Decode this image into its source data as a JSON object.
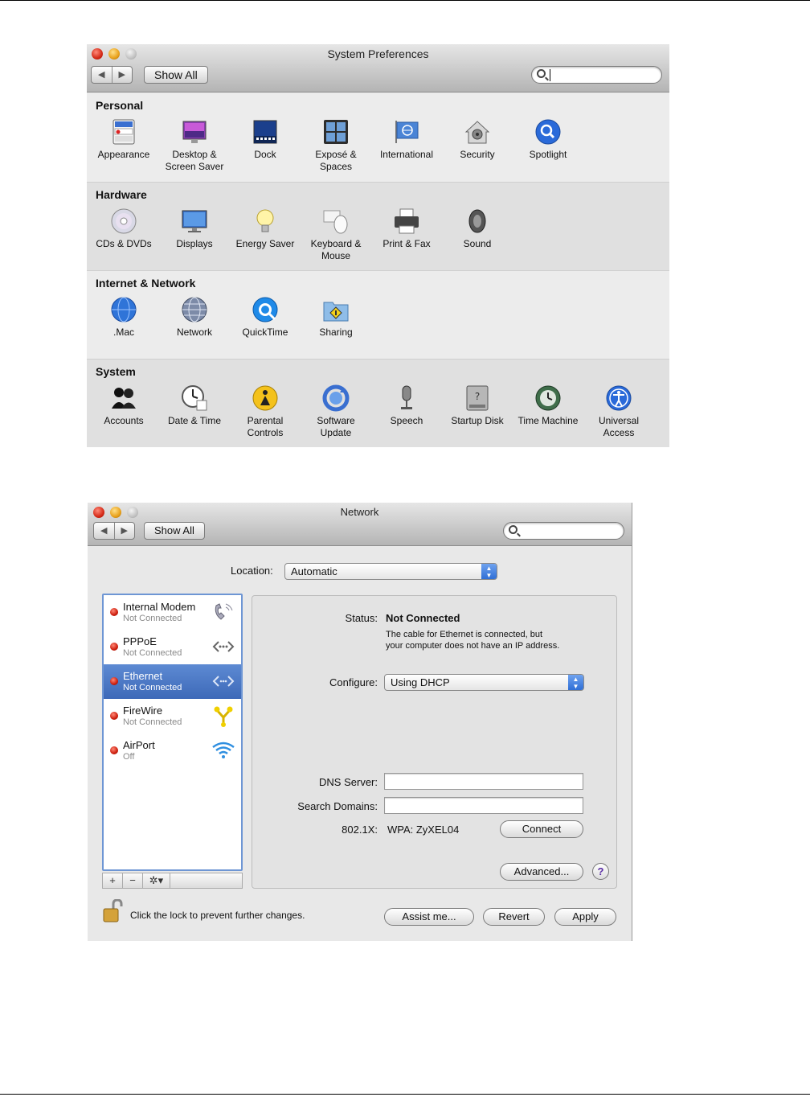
{
  "system_preferences": {
    "title": "System Preferences",
    "nav_back": "◀",
    "nav_forward": "▶",
    "show_all": "Show All",
    "sections": [
      {
        "title": "Personal",
        "panes": [
          {
            "label": "Appearance",
            "icon": "appearance-icon"
          },
          {
            "label": "Desktop & Screen Saver",
            "icon": "desktop-icon"
          },
          {
            "label": "Dock",
            "icon": "dock-icon"
          },
          {
            "label": "Exposé & Spaces",
            "icon": "expose-icon"
          },
          {
            "label": "International",
            "icon": "international-icon"
          },
          {
            "label": "Security",
            "icon": "security-icon"
          },
          {
            "label": "Spotlight",
            "icon": "spotlight-icon"
          }
        ]
      },
      {
        "title": "Hardware",
        "panes": [
          {
            "label": "CDs & DVDs",
            "icon": "cd-icon"
          },
          {
            "label": "Displays",
            "icon": "display-icon"
          },
          {
            "label": "Energy Saver",
            "icon": "bulb-icon"
          },
          {
            "label": "Keyboard & Mouse",
            "icon": "keyboard-mouse-icon"
          },
          {
            "label": "Print & Fax",
            "icon": "printer-icon"
          },
          {
            "label": "Sound",
            "icon": "speaker-icon"
          }
        ]
      },
      {
        "title": "Internet & Network",
        "panes": [
          {
            "label": ".Mac",
            "icon": "globe-icon"
          },
          {
            "label": "Network",
            "icon": "network-globe-icon"
          },
          {
            "label": "QuickTime",
            "icon": "quicktime-icon"
          },
          {
            "label": "Sharing",
            "icon": "sharing-folder-icon"
          }
        ]
      },
      {
        "title": "System",
        "panes": [
          {
            "label": "Accounts",
            "icon": "accounts-icon"
          },
          {
            "label": "Date & Time",
            "icon": "clock-icon"
          },
          {
            "label": "Parental Controls",
            "icon": "parental-icon"
          },
          {
            "label": "Software Update",
            "icon": "update-icon"
          },
          {
            "label": "Speech",
            "icon": "microphone-icon"
          },
          {
            "label": "Startup Disk",
            "icon": "disk-icon"
          },
          {
            "label": "Time Machine",
            "icon": "time-machine-icon"
          },
          {
            "label": "Universal Access",
            "icon": "universal-access-icon"
          }
        ]
      }
    ]
  },
  "network": {
    "title": "Network",
    "show_all": "Show All",
    "location_label": "Location:",
    "location_value": "Automatic",
    "services": [
      {
        "name": "Internal Modem",
        "status": "Not Connected",
        "icon": "phone-icon",
        "selected": false
      },
      {
        "name": "PPPoE",
        "status": "Not Connected",
        "icon": "pppoe-arrows-icon",
        "selected": false
      },
      {
        "name": "Ethernet",
        "status": "Not Connected",
        "icon": "ethernet-arrows-icon",
        "selected": true
      },
      {
        "name": "FireWire",
        "status": "Not Connected",
        "icon": "firewire-icon",
        "selected": false
      },
      {
        "name": "AirPort",
        "status": "Off",
        "icon": "wifi-icon",
        "selected": false
      }
    ],
    "list_footer": {
      "add": "+",
      "remove": "−",
      "gear": "✲▾"
    },
    "status_label": "Status:",
    "status_value": "Not Connected",
    "status_desc_1": "The cable for Ethernet is connected, but",
    "status_desc_2": "your computer does not have an IP address.",
    "configure_label": "Configure:",
    "configure_value": "Using DHCP",
    "dns_label": "DNS Server:",
    "dns_value": "",
    "search_domains_label": "Search Domains:",
    "search_domains_value": "",
    "dot1x_label": "802.1X:",
    "dot1x_value": "WPA: ZyXEL04",
    "connect_button": "Connect",
    "advanced_button": "Advanced...",
    "help_button": "?",
    "lock_text": "Click the lock to prevent further changes.",
    "assist_button": "Assist me...",
    "revert_button": "Revert",
    "apply_button": "Apply"
  },
  "colors": {
    "highlight_circle": "#d6051b",
    "selection": "#3d69b8",
    "status_red": "#cc1d0c"
  }
}
